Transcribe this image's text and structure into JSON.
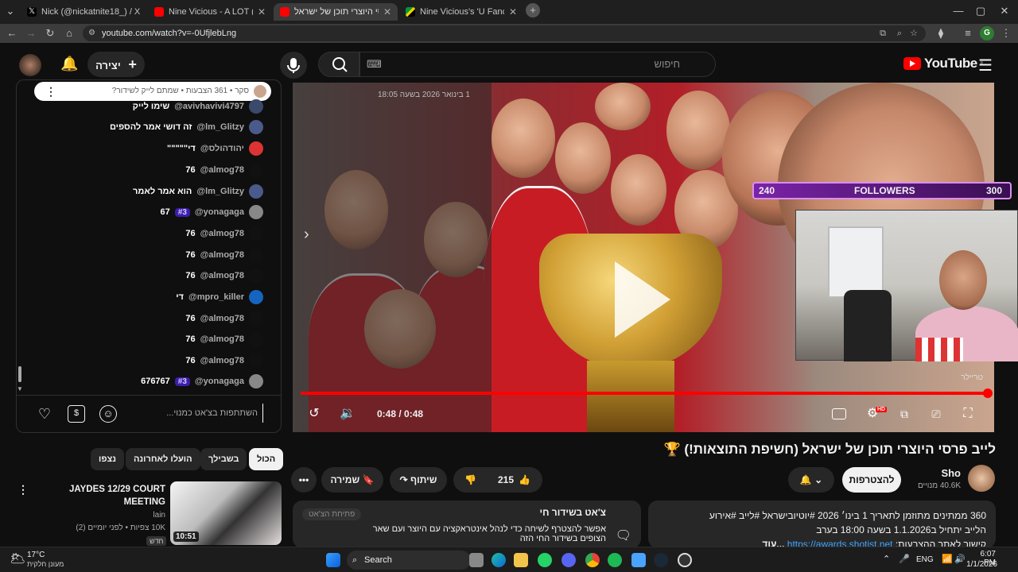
{
  "browser": {
    "tabs": [
      {
        "title": "Nick (@nickatnite18_) / X",
        "active": false
      },
      {
        "title": "Nine Vicious - A LOT (Official M",
        "active": false
      },
      {
        "title": "לייב פרסי היוצרי תוכן של ישראל",
        "active": true
      },
      {
        "title": "Nine Vicious's 'U Fancy' sample",
        "active": false
      }
    ],
    "url": "youtube.com/watch?v=-0UfjlebLng",
    "profile_initial": "G"
  },
  "youtube": {
    "logo": "YouTube",
    "logo_region": "IL",
    "search_placeholder": "חיפוש",
    "create_label": "יצירה"
  },
  "chat": {
    "pinned_text": "סקר • 361 הצבעות • שמתם לייק לשידור?",
    "messages": [
      {
        "author": "@avivhavivi4797",
        "text": "שימו לייק",
        "badge": "",
        "avatar_color": "#3a4a6b"
      },
      {
        "author": "@lm_Glitzy",
        "text": "זה דושי אמר להספים",
        "badge": "",
        "avatar_color": "#4a5a8a"
      },
      {
        "author": "@יהודהולס",
        "text": "די\"\"\"\"\"",
        "badge": "",
        "avatar_color": "#d33"
      },
      {
        "author": "@almog78",
        "text": "76",
        "badge": "",
        "avatar_color": "#111"
      },
      {
        "author": "@lm_Glitzy",
        "text": "הוא אמר לאמר",
        "badge": "",
        "avatar_color": "#4a5a8a"
      },
      {
        "author": "@yonagaga",
        "text": "67",
        "badge": "#3",
        "avatar_color": "#888"
      },
      {
        "author": "@almog78",
        "text": "76",
        "badge": "",
        "avatar_color": "#111"
      },
      {
        "author": "@almog78",
        "text": "76",
        "badge": "",
        "avatar_color": "#111"
      },
      {
        "author": "@almog78",
        "text": "76",
        "badge": "",
        "avatar_color": "#111"
      },
      {
        "author": "@mpro_killer",
        "text": "די",
        "badge": "",
        "avatar_color": "#1565c0"
      },
      {
        "author": "@almog78",
        "text": "76",
        "badge": "",
        "avatar_color": "#111"
      },
      {
        "author": "@almog78",
        "text": "76",
        "badge": "",
        "avatar_color": "#111"
      },
      {
        "author": "@almog78",
        "text": "76",
        "badge": "",
        "avatar_color": "#111"
      },
      {
        "author": "@yonagaga",
        "text": "676767",
        "badge": "#3",
        "avatar_color": "#888"
      }
    ],
    "input_placeholder": "השתתפות בצ'אט כמנוי..."
  },
  "chips": [
    "הכול",
    "בשבילך",
    "הועלו לאחרונה",
    "נצפו"
  ],
  "player": {
    "stream_date_overlay": "1 בינואר 2026 בשעה 18:05",
    "time": "0:48 / 0:48",
    "trailer_label": "טריילר",
    "followers": {
      "left": "240",
      "label": "FOLLOWERS",
      "right": "300"
    },
    "hd_badge": "HD"
  },
  "video": {
    "title": "לייב פרסי היוצרי תוכן של ישראל (חשיפת התוצאות!) 🏆",
    "channel": "Sho",
    "subscribers": "40.6K מנויים",
    "subscribe_label": "להצטרפות",
    "likes": "215",
    "share_label": "שיתוף",
    "save_label": "שמירה"
  },
  "description": {
    "line1": "360 ממתינים  מתוזמן לתאריך 1 בינו׳ 2026  #יוטיובישראל #לייב #אירוע",
    "line2": "הלייב יתחיל ב1.1.2026 בשעה 18:00 בערב",
    "line3_prefix": "קישור לאתר ההצבעות: ",
    "link": "https://awards.shotist.net",
    "more": "...עוד"
  },
  "live_chat_box": {
    "title": "צ'אט בשידור חי",
    "line": "אפשר להצטרף לשיחה כדי לנהל אינטראקציה עם היוצר ועם שאר",
    "line2": "הצופים בשידור החי הזה",
    "button": "פתיחת הצ'אט"
  },
  "recommendation": {
    "title": "JAYDES 12/29 COURT MEETING",
    "channel": "lain",
    "meta": "10K צפיות • לפני יומיים (2)",
    "badge": "חדש",
    "duration": "10:51"
  },
  "taskbar": {
    "weather_temp": "17°C",
    "weather_desc": "מעונן חלקית",
    "search": "Search",
    "lang": "ENG",
    "time": "6:07 PM",
    "date": "1/1/2026"
  }
}
